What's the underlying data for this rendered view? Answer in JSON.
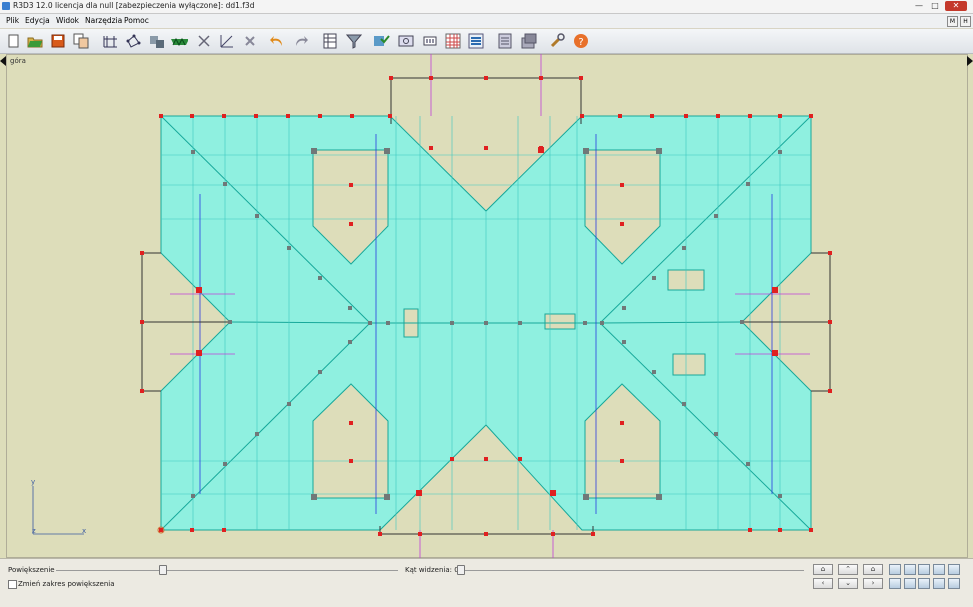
{
  "window": {
    "title": "R3D3 12.0 licencja dla null [zabezpieczenia wyłączone]: dd1.f3d",
    "minimize_label": "—",
    "maximize_label": "□",
    "close_label": "✕"
  },
  "menu": {
    "items": [
      {
        "label": "Plik"
      },
      {
        "label": "Edycja"
      },
      {
        "label": "Widok"
      },
      {
        "label": "Narzędzia"
      },
      {
        "label": "Pomoc"
      }
    ],
    "right_buttons": [
      "M",
      "H"
    ]
  },
  "toolbar": {
    "icons": [
      "new-file-icon",
      "open-folder-icon",
      "save-icon",
      "copy-icon",
      "axes-icon",
      "nodes-icon",
      "stack-icon",
      "truss-icon",
      "scissors-icon",
      "measure-icon",
      "delete-x-icon",
      "undo-icon",
      "redo-icon",
      "table-icon",
      "filter-icon",
      "analysis-icon",
      "display-icon",
      "id-icon",
      "grid-icon",
      "layers-icon",
      "properties-icon",
      "print-icon",
      "tools-icon",
      "help-icon"
    ]
  },
  "viewport": {
    "label": "góra",
    "axis_y": "y",
    "axis_z": "z",
    "axis_x": "x",
    "colors": {
      "background": "#ddddba",
      "roof_fill": "#8ff0e0",
      "roof_edge": "#17a89a",
      "node_red": "#e02020",
      "node_gray": "#707878",
      "purple_line": "#c040d8",
      "blue_line": "#2a3ce0"
    }
  },
  "bottom": {
    "zoom_label": "Powiększenie",
    "zoom_range_label": "Zmień zakres powiększenia",
    "angle_label": "Kąt widzenia: 00",
    "zoom_value": 0.31,
    "angle_value": 0.0,
    "nav_labels": [
      "⌂",
      "⌃",
      "⌂",
      "‹",
      "⌄",
      "›"
    ]
  }
}
